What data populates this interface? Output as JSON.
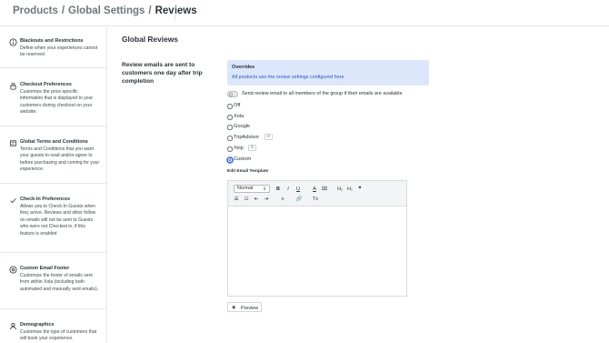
{
  "breadcrumb": {
    "items": [
      "Products",
      "Global Settings",
      "Reviews"
    ],
    "separator": "/"
  },
  "sidebar": {
    "items": [
      {
        "icon": "info-icon",
        "title": "Blackouts and Restrictions",
        "description": "Define when your experiences cannot be reserved"
      },
      {
        "icon": "lock-icon",
        "title": "Checkout Preferences",
        "description": "Customize the price-specific information that is displayed to your customers during checkout on your website."
      },
      {
        "icon": "document-icon",
        "title": "Global Terms and Conditions",
        "description": "Terms and Conditions that you want your guests to read and/or agree to before purchasing and coming for your experience."
      },
      {
        "icon": "check-icon",
        "title": "Check-In Preferences",
        "description": "Allows you to Check-In Guests when they arrive. Reviews and other follow on emails will not be sent to Guests who were not Checked in, if this feature is enabled"
      },
      {
        "icon": "at-icon",
        "title": "Custom Email Footer",
        "description": "Customize the footer of emails sent from within Xola (including both automated and manually sent emails)."
      },
      {
        "icon": "user-icon",
        "title": "Demographics",
        "description": "Customize the type of customers that will book your experience."
      }
    ]
  },
  "main": {
    "title": "Global Reviews",
    "section_text": "Review emails are sent to customers one day after trip completion",
    "overrides": {
      "heading": "Overrides",
      "link": "All products use the review settings configured here"
    },
    "toggle": {
      "label": "Send review email to all members of the group if their emails are available",
      "checked": false
    },
    "review_options": [
      {
        "label": "Off",
        "selected": false,
        "badge": false
      },
      {
        "label": "Xola",
        "selected": false,
        "badge": false
      },
      {
        "label": "Google",
        "selected": false,
        "badge": false
      },
      {
        "label": "TripAdvisor",
        "selected": false,
        "badge": true
      },
      {
        "label": "Yelp",
        "selected": false,
        "badge": true
      },
      {
        "label": "Custom",
        "selected": true,
        "badge": false
      }
    ],
    "edit_template_label": "Edit Email Template",
    "editor": {
      "format_select": "Normal",
      "format_caret": "⇕",
      "tools_row1": [
        "B",
        "I",
        "U",
        "A",
        "⌧",
        "H₁",
        "H₂",
        "❞"
      ],
      "tools_row2": [
        "☰",
        "☷",
        "⇤",
        "⇥",
        "≡",
        "🔗",
        "Tx"
      ],
      "content": ""
    },
    "preview_button": "Preview",
    "preview_icon": "eye-icon"
  },
  "colors": {
    "accent": "#2c58c7",
    "overrides_bg": "#dce7fb",
    "text": "#2a3338",
    "muted": "#6f767b"
  }
}
